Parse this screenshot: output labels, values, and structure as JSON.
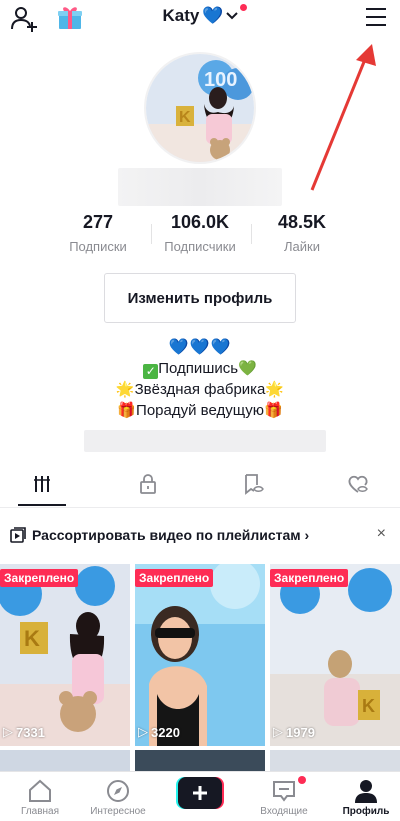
{
  "header": {
    "title": "Katy",
    "heart": "💙",
    "accent_dot_color": "#fe2c55"
  },
  "stats": [
    {
      "value": "277",
      "label": "Подписки"
    },
    {
      "value": "106.0K",
      "label": "Подписчики"
    },
    {
      "value": "48.5K",
      "label": "Лайки"
    }
  ],
  "edit_profile_label": "Изменить профиль",
  "bio": {
    "line1": "💙💙💙",
    "line2_check": "✓",
    "line2_text": "Подпишись",
    "line2_heart": "💚",
    "line3_star": "🌟",
    "line3_text": "Звёздная фабрика",
    "line4_gift": "🎁",
    "line4_text": "Порадуй ведущую"
  },
  "playlist_banner": {
    "text": "Рассортировать видео по плейлистам",
    "arrow": "›",
    "close": "×"
  },
  "videos": [
    {
      "pinned": "Закреплено",
      "views": "7331"
    },
    {
      "pinned": "Закреплено",
      "views": "3220"
    },
    {
      "pinned": "Закреплено",
      "views": "1979"
    }
  ],
  "bottom_nav": [
    {
      "label": "Главная",
      "icon": "home-icon"
    },
    {
      "label": "Интересное",
      "icon": "compass-icon"
    },
    {
      "label": "",
      "icon": "plus-icon"
    },
    {
      "label": "Входящие",
      "icon": "inbox-icon"
    },
    {
      "label": "Профиль",
      "icon": "profile-icon"
    }
  ],
  "colors": {
    "accent": "#fe2c55",
    "heart_blue": "#2b8ae8",
    "text": "#161823",
    "muted": "#8a8b91"
  }
}
